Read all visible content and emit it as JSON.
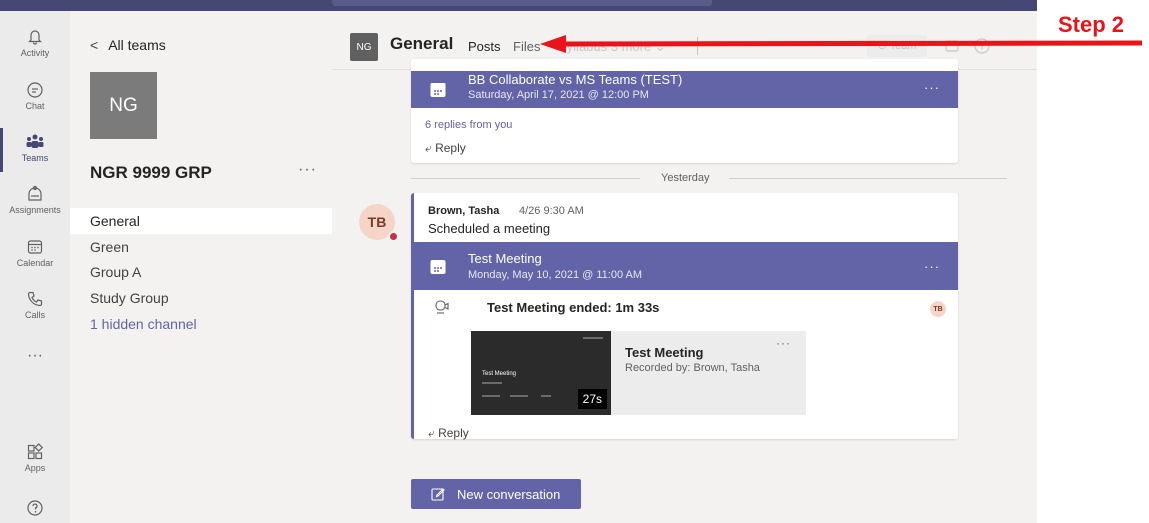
{
  "rail": {
    "items": [
      {
        "label": "Activity",
        "icon": "bell-icon"
      },
      {
        "label": "Chat",
        "icon": "chat-icon"
      },
      {
        "label": "Teams",
        "icon": "teams-icon"
      },
      {
        "label": "Assignments",
        "icon": "assignments-icon"
      },
      {
        "label": "Calendar",
        "icon": "calendar-icon"
      },
      {
        "label": "Calls",
        "icon": "phone-icon"
      }
    ],
    "more": "···",
    "apps_label": "Apps",
    "help_icon": "help-icon"
  },
  "team_panel": {
    "back_label": "All teams",
    "avatar_initials": "NG",
    "team_name": "NGR 9999 GRP",
    "more": "···",
    "channels": [
      "General",
      "Green",
      "Group A",
      "Study Group"
    ],
    "hidden_channels": "1 hidden channel",
    "selected_channel": "General"
  },
  "channel_header": {
    "avatar_initials": "NG",
    "title": "General",
    "tabs": {
      "posts": "Posts",
      "files": "Files"
    },
    "faded_tabs": "Syllabus   3 more  ⌄",
    "team_button": "⊙ Team"
  },
  "feed": {
    "meeting1": {
      "title": "BB Collaborate vs MS Teams (TEST)",
      "subtitle": "Saturday, April 17, 2021 @ 12:00 PM",
      "more": "···",
      "replies": "6 replies from you",
      "reply_label": "Reply"
    },
    "day_divider": "Yesterday",
    "post": {
      "avatar_initials": "TB",
      "author": "Brown, Tasha",
      "time": "4/26 9:30 AM",
      "body": "Scheduled a meeting",
      "meeting": {
        "title": "Test Meeting",
        "subtitle": "Monday, May 10, 2021 @ 11:00 AM",
        "more": "···"
      },
      "ended": "Test Meeting ended: 1m 33s",
      "ended_avatar": "TB",
      "recording": {
        "thumb_title": "Test Meeting",
        "duration": "27s",
        "title": "Test Meeting",
        "recorded_by": "Recorded by: Brown, Tasha",
        "more": "···"
      },
      "reply_label": "Reply"
    }
  },
  "new_conversation": "New conversation",
  "annotation": {
    "step_label": "Step 2",
    "color": "#e8141a"
  },
  "colors": {
    "accent": "#6264a7",
    "rail_bg": "#ebebeb",
    "panel_bg": "#f3f2f1",
    "top_bar": "#464775"
  }
}
